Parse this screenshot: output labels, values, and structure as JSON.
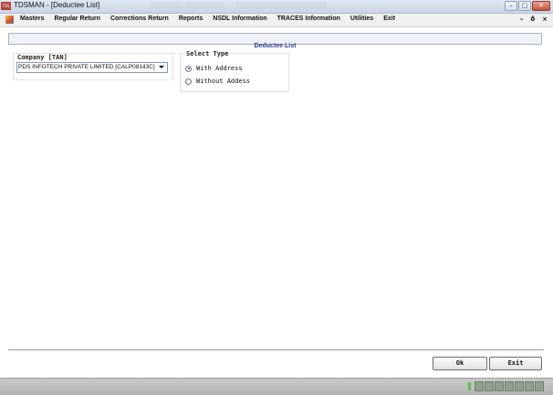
{
  "window": {
    "title": "TDSMAN - [Deductee List]",
    "icon": "tdsman-app-icon",
    "buttons": {
      "minimize": "–",
      "maximize": "▢",
      "close": "✕"
    }
  },
  "menubar": {
    "items": [
      "Masters",
      "Regular Return",
      "Corrections Return",
      "Reports",
      "NSDL Information",
      "TRACES Information",
      "Utilities",
      "Exit"
    ],
    "mdi": {
      "minimize": "–",
      "restore": "ð",
      "close": "×"
    }
  },
  "form": {
    "header": "Deductee List",
    "company": {
      "label": "Company [TAN]",
      "value": "PDS INFOTECH PRIVATE LIMITED [CALP08143C]"
    },
    "select_type": {
      "label": "Select Type",
      "options": [
        {
          "label": "With Address",
          "checked": true
        },
        {
          "label": "Without Addess",
          "checked": false
        }
      ]
    },
    "buttons": {
      "ok": "Ok",
      "exit": "Exit"
    }
  },
  "colors": {
    "header_text": "#2a3b8f",
    "titlebar": "#c9d6e6",
    "status_indicator": "#5ac24a"
  }
}
